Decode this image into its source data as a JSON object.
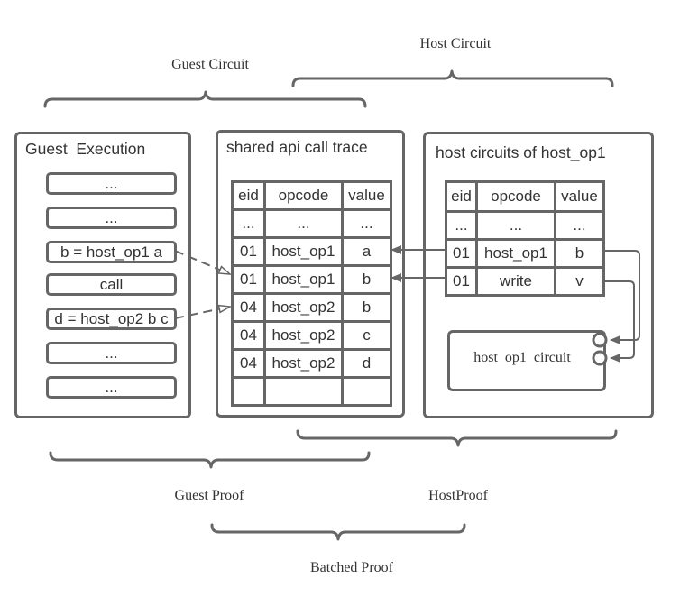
{
  "braces": {
    "guest_circuit": "Guest Circuit",
    "host_circuit": "Host Circuit",
    "guest_proof": "Guest Proof",
    "host_proof": "HostProof",
    "batched_proof": "Batched Proof"
  },
  "guest_execution": {
    "title": "Guest  Execution",
    "steps": [
      "...",
      "...",
      "b = host_op1 a",
      "call",
      "d = host_op2 b c",
      "...",
      "..."
    ]
  },
  "shared_trace": {
    "title": "shared api call trace",
    "columns": [
      "eid",
      "opcode",
      "value"
    ],
    "rows": [
      [
        "...",
        "...",
        "..."
      ],
      [
        "01",
        "host_op1",
        "a"
      ],
      [
        "01",
        "host_op1",
        "b"
      ],
      [
        "04",
        "host_op2",
        "b"
      ],
      [
        "04",
        "host_op2",
        "c"
      ],
      [
        "04",
        "host_op2",
        "d"
      ],
      [
        "",
        "",
        ""
      ]
    ]
  },
  "host_circuits": {
    "title": "host circuits of host_op1",
    "columns": [
      "eid",
      "opcode",
      "value"
    ],
    "rows": [
      [
        "...",
        "...",
        "..."
      ],
      [
        "01",
        "host_op1",
        "b"
      ],
      [
        "01",
        "write",
        "v"
      ]
    ],
    "circuit_label": "host_op1_circuit"
  },
  "colors": {
    "stroke": "#666666",
    "text": "#333333"
  }
}
